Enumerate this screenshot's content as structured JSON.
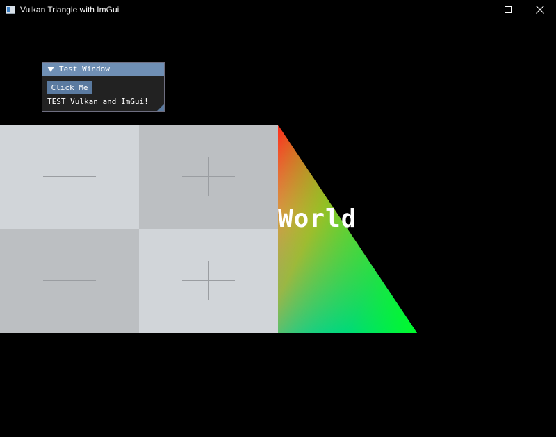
{
  "window": {
    "title": "Vulkan Triangle with ImGui",
    "icon": "app-window-icon",
    "controls": [
      "minimize-icon",
      "maximize-icon",
      "close-icon"
    ]
  },
  "scene": {
    "overlay_text": "World",
    "colors": {
      "background": "#000000",
      "checker_light": "#d1d5d9",
      "checker_dark": "#bcbfc2",
      "triangle_top": "#ff2a1a",
      "triangle_bottom_left": "#00b8c8",
      "triangle_bottom_right": "#00ff20"
    }
  },
  "imgui": {
    "title": "Test Window",
    "button_label": "Click Me",
    "text": "TEST Vulkan and ImGui!",
    "colors": {
      "title_bg": "#6f8fb4",
      "window_bg": "#242424",
      "button_bg": "#5a7aa0"
    }
  }
}
